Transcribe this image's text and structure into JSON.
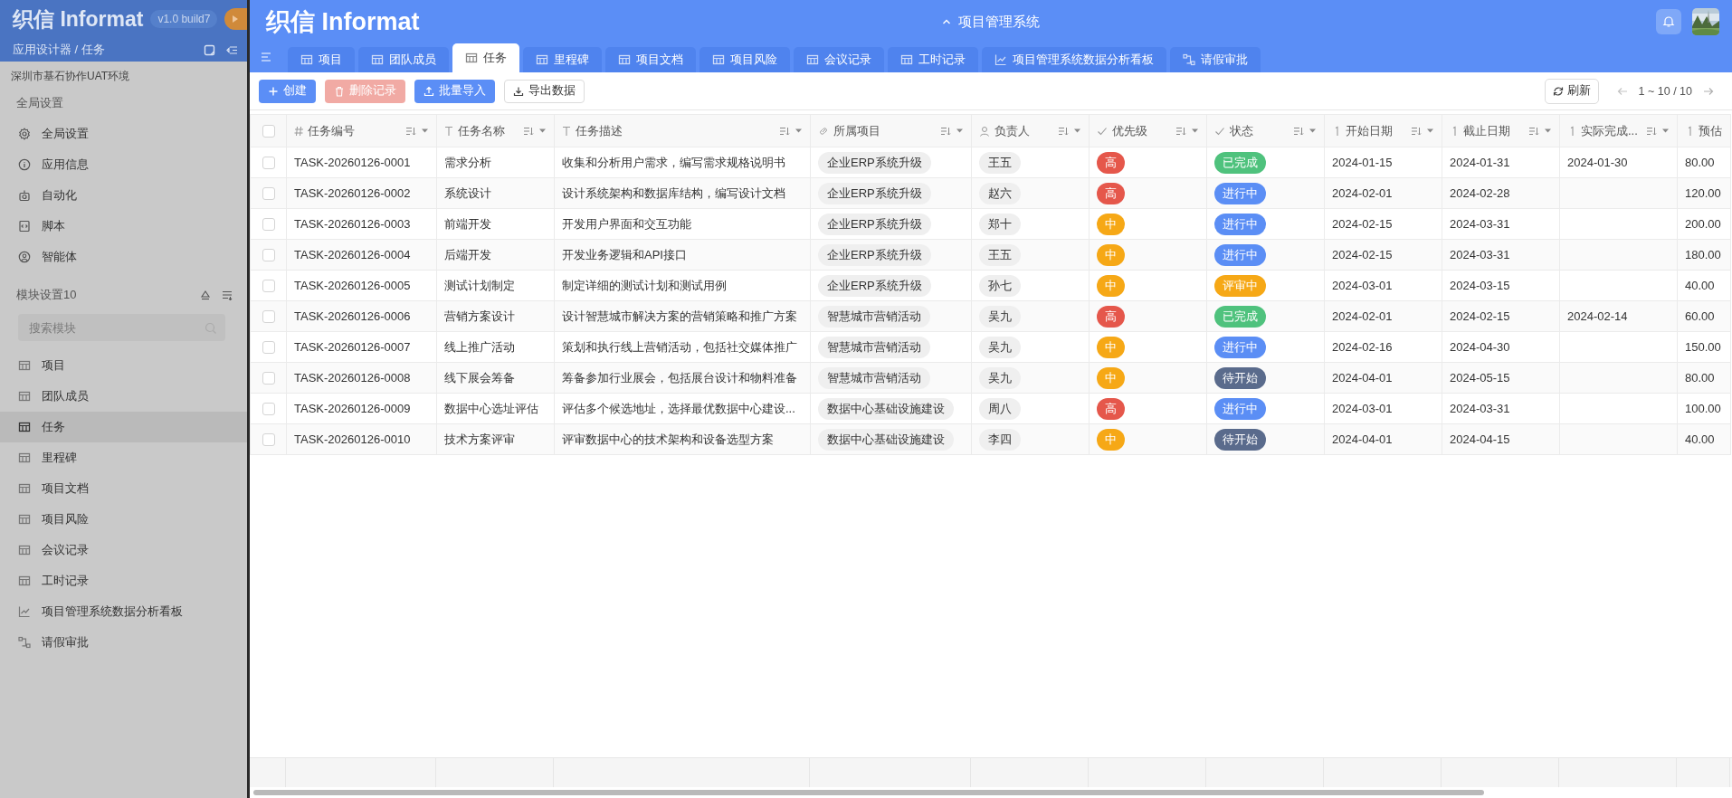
{
  "sidebar": {
    "logo": "织信 Informat",
    "version": "v1.0 build7",
    "breadcrumb": "应用设计器 / 任务",
    "environment": "深圳市基石协作UAT环境",
    "global_title": "全局设置",
    "global_items": [
      {
        "label": "全局设置"
      },
      {
        "label": "应用信息"
      },
      {
        "label": "自动化"
      },
      {
        "label": "脚本"
      },
      {
        "label": "智能体"
      }
    ],
    "module_title": "模块设置10",
    "search": {
      "placeholder": "搜索模块"
    },
    "module_items": [
      {
        "label": "项目",
        "kind": "table",
        "selected": false
      },
      {
        "label": "团队成员",
        "kind": "table",
        "selected": false
      },
      {
        "label": "任务",
        "kind": "table",
        "selected": true
      },
      {
        "label": "里程碑",
        "kind": "table",
        "selected": false
      },
      {
        "label": "项目文档",
        "kind": "table",
        "selected": false
      },
      {
        "label": "项目风险",
        "kind": "table",
        "selected": false
      },
      {
        "label": "会议记录",
        "kind": "table",
        "selected": false
      },
      {
        "label": "工时记录",
        "kind": "table",
        "selected": false
      },
      {
        "label": "项目管理系统数据分析看板",
        "kind": "dashboard",
        "selected": false
      },
      {
        "label": "请假审批",
        "kind": "workflow",
        "selected": false
      }
    ]
  },
  "header": {
    "logo": "织信 Informat",
    "app_title": "项目管理系统"
  },
  "tabs": [
    {
      "label": "项目",
      "kind": "table",
      "selected": false
    },
    {
      "label": "团队成员",
      "kind": "table",
      "selected": false
    },
    {
      "label": "任务",
      "kind": "table",
      "selected": true
    },
    {
      "label": "里程碑",
      "kind": "table",
      "selected": false
    },
    {
      "label": "项目文档",
      "kind": "table",
      "selected": false
    },
    {
      "label": "项目风险",
      "kind": "table",
      "selected": false
    },
    {
      "label": "会议记录",
      "kind": "table",
      "selected": false
    },
    {
      "label": "工时记录",
      "kind": "table",
      "selected": false
    },
    {
      "label": "项目管理系统数据分析看板",
      "kind": "dashboard",
      "selected": false
    },
    {
      "label": "请假审批",
      "kind": "workflow",
      "selected": false
    }
  ],
  "toolbar": {
    "buttons": [
      {
        "label": "创建",
        "kind": "primary",
        "disabled": false
      },
      {
        "label": "删除记录",
        "kind": "danger",
        "disabled": true
      },
      {
        "label": "批量导入",
        "kind": "primary",
        "disabled": false
      },
      {
        "label": "导出数据",
        "kind": "outline",
        "disabled": false
      }
    ],
    "refresh": "刷新",
    "pagination": "1 ~ 10 / 10"
  },
  "table": {
    "select_all_checked": false,
    "columns": [
      {
        "label": "任务编号",
        "kind": "id"
      },
      {
        "label": "任务名称",
        "kind": "text"
      },
      {
        "label": "任务描述",
        "kind": "text"
      },
      {
        "label": "所属项目",
        "kind": "link"
      },
      {
        "label": "负责人",
        "kind": "user"
      },
      {
        "label": "优先级",
        "kind": "select"
      },
      {
        "label": "状态",
        "kind": "select"
      },
      {
        "label": "开始日期",
        "kind": "date"
      },
      {
        "label": "截止日期",
        "kind": "date"
      },
      {
        "label": "实际完成...",
        "kind": "date"
      },
      {
        "label": "预估",
        "kind": "number"
      }
    ],
    "rows": [
      {
        "checked": false,
        "id": "TASK-20260126-0001",
        "name": "需求分析",
        "description": "收集和分析用户需求，编写需求规格说明书",
        "project": "企业ERP系统升级",
        "owner": "王五",
        "priority": {
          "label": "高",
          "color": "#e5574b"
        },
        "status": {
          "label": "已完成",
          "color": "#4fc27d"
        },
        "start": "2024-01-15",
        "due": "2024-01-31",
        "completed": "2024-01-30",
        "estimate": "80.00"
      },
      {
        "checked": false,
        "id": "TASK-20260126-0002",
        "name": "系统设计",
        "description": "设计系统架构和数据库结构，编写设计文档",
        "project": "企业ERP系统升级",
        "owner": "赵六",
        "priority": {
          "label": "高",
          "color": "#e5574b"
        },
        "status": {
          "label": "进行中",
          "color": "#5b8ef5"
        },
        "start": "2024-02-01",
        "due": "2024-02-28",
        "estimate": "120.00"
      },
      {
        "checked": false,
        "id": "TASK-20260126-0003",
        "name": "前端开发",
        "description": "开发用户界面和交互功能",
        "project": "企业ERP系统升级",
        "owner": "郑十",
        "priority": {
          "label": "中",
          "color": "#f6a816"
        },
        "status": {
          "label": "进行中",
          "color": "#5b8ef5"
        },
        "start": "2024-02-15",
        "due": "2024-03-31",
        "estimate": "200.00"
      },
      {
        "checked": false,
        "id": "TASK-20260126-0004",
        "name": "后端开发",
        "description": "开发业务逻辑和API接口",
        "project": "企业ERP系统升级",
        "owner": "王五",
        "priority": {
          "label": "中",
          "color": "#f6a816"
        },
        "status": {
          "label": "进行中",
          "color": "#5b8ef5"
        },
        "start": "2024-02-15",
        "due": "2024-03-31",
        "estimate": "180.00"
      },
      {
        "checked": false,
        "id": "TASK-20260126-0005",
        "name": "测试计划制定",
        "description": "制定详细的测试计划和测试用例",
        "project": "企业ERP系统升级",
        "owner": "孙七",
        "priority": {
          "label": "中",
          "color": "#f6a816"
        },
        "status": {
          "label": "评审中",
          "color": "#f6a816"
        },
        "start": "2024-03-01",
        "due": "2024-03-15",
        "estimate": "40.00"
      },
      {
        "checked": false,
        "id": "TASK-20260126-0006",
        "name": "营销方案设计",
        "description": "设计智慧城市解决方案的营销策略和推广方案",
        "project": "智慧城市营销活动",
        "owner": "吴九",
        "priority": {
          "label": "高",
          "color": "#e5574b"
        },
        "status": {
          "label": "已完成",
          "color": "#4fc27d"
        },
        "start": "2024-02-01",
        "due": "2024-02-15",
        "completed": "2024-02-14",
        "estimate": "60.00"
      },
      {
        "checked": false,
        "id": "TASK-20260126-0007",
        "name": "线上推广活动",
        "description": "策划和执行线上营销活动，包括社交媒体推广",
        "project": "智慧城市营销活动",
        "owner": "吴九",
        "priority": {
          "label": "中",
          "color": "#f6a816"
        },
        "status": {
          "label": "进行中",
          "color": "#5b8ef5"
        },
        "start": "2024-02-16",
        "due": "2024-04-30",
        "estimate": "150.00"
      },
      {
        "checked": false,
        "id": "TASK-20260126-0008",
        "name": "线下展会筹备",
        "description": "筹备参加行业展会，包括展台设计和物料准备",
        "project": "智慧城市营销活动",
        "owner": "吴九",
        "priority": {
          "label": "中",
          "color": "#f6a816"
        },
        "status": {
          "label": "待开始",
          "color": "#5a6b8c"
        },
        "start": "2024-04-01",
        "due": "2024-05-15",
        "estimate": "80.00"
      },
      {
        "checked": false,
        "id": "TASK-20260126-0009",
        "name": "数据中心选址评估",
        "description": "评估多个候选地址，选择最优数据中心建设...",
        "project": "数据中心基础设施建设",
        "owner": "周八",
        "priority": {
          "label": "高",
          "color": "#e5574b"
        },
        "status": {
          "label": "进行中",
          "color": "#5b8ef5"
        },
        "start": "2024-03-01",
        "due": "2024-03-31",
        "estimate": "100.00"
      },
      {
        "checked": false,
        "id": "TASK-20260126-0010",
        "name": "技术方案评审",
        "description": "评审数据中心的技术架构和设备选型方案",
        "project": "数据中心基础设施建设",
        "owner": "李四",
        "priority": {
          "label": "中",
          "color": "#f6a816"
        },
        "status": {
          "label": "待开始",
          "color": "#5a6b8c"
        },
        "start": "2024-04-01",
        "due": "2024-04-15",
        "estimate": "40.00"
      }
    ]
  }
}
